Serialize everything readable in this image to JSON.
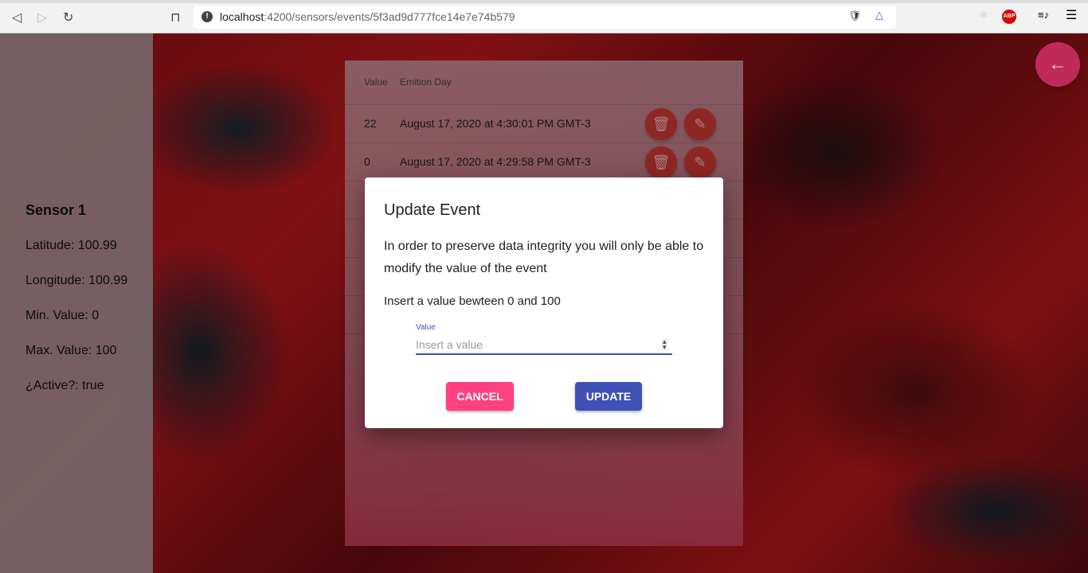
{
  "browser": {
    "url_host": "localhost",
    "url_path": ":4200/sensors/events/5f3ad9d777fce14e7e74b579",
    "abp_label": "ABP"
  },
  "sensor": {
    "name": "Sensor 1",
    "latitude": "Latitude: 100.99",
    "longitude": "Longitude: 100.99",
    "min": "Min. Value: 0",
    "max": "Max. Value: 100",
    "active": "¿Active?: true"
  },
  "table": {
    "headers": [
      "Value",
      "Emition Day"
    ],
    "rows": [
      {
        "value": "22",
        "date": "August 17, 2020 at 4:30:01 PM GMT-3"
      },
      {
        "value": "0",
        "date": "August 17, 2020 at 4:29:58 PM GMT-3"
      }
    ]
  },
  "dialog": {
    "title": "Update Event",
    "message": "In order to preserve data integrity you will only be able to modify the value of the event",
    "hint": "Insert a value bewteen 0 and 100",
    "field_label": "Value",
    "placeholder": "Insert a value",
    "cancel": "CANCEL",
    "update": "UPDATE"
  },
  "colors": {
    "cancel": "#ff4081",
    "update": "#3f51b5",
    "fab": "#d23a36",
    "back": "#c02a5a"
  }
}
